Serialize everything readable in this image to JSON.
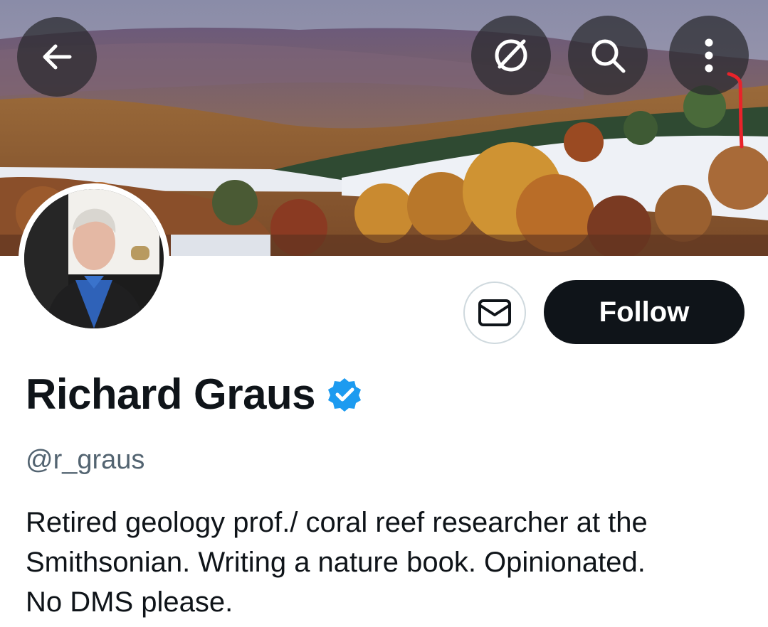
{
  "header": {
    "back_icon": "arrow-left-icon",
    "grok_icon": "slash-circle-icon",
    "search_icon": "search-icon",
    "more_icon": "more-vertical-icon"
  },
  "profile": {
    "display_name": "Richard Graus",
    "verified": true,
    "verified_color": "#1d9bf0",
    "handle": "@r_graus",
    "bio_lines": [
      "Retired geology prof./ coral reef researcher at the",
      "Smithsonian.  Writing a nature book.  Opinionated.",
      "No DMS please."
    ]
  },
  "actions": {
    "message_icon": "envelope-icon",
    "follow_label": "Follow"
  },
  "colors": {
    "text_primary": "#0f1419",
    "text_secondary": "#536471",
    "button_dark": "#0f1419",
    "annotation_red": "#e8232a"
  }
}
